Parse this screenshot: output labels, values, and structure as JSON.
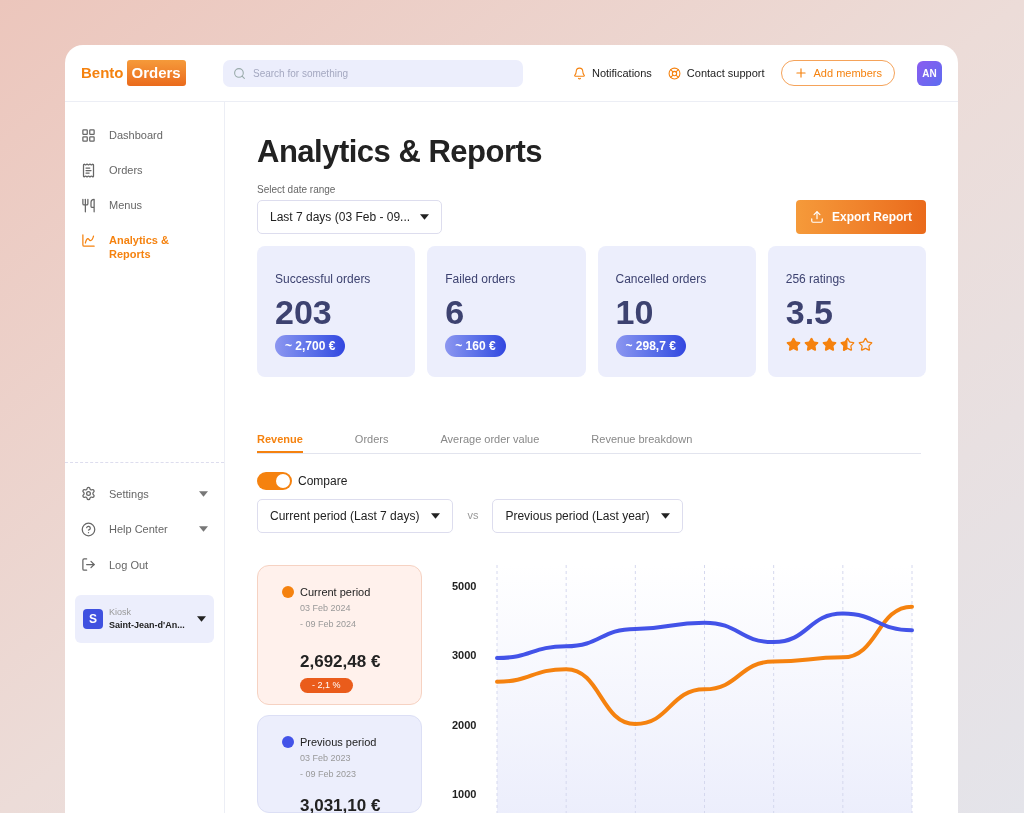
{
  "logo": {
    "part_1": "Bento",
    "part_2": "Orders"
  },
  "search": {
    "placeholder": "Search for something"
  },
  "header_actions": [
    {
      "label": "Notifications",
      "kind": "bell"
    },
    {
      "label": "Contact support",
      "kind": "lifebuoy"
    }
  ],
  "add_button": "Add members",
  "avatar": "AN",
  "sidebar": {
    "items": [
      {
        "label": "Dashboard",
        "kind": "grid",
        "selected": false
      },
      {
        "label": "Orders",
        "kind": "list",
        "selected": false
      },
      {
        "label": "Menus",
        "kind": "cutlery",
        "selected": false
      },
      {
        "label": "Analytics & Reports",
        "kind": "chart",
        "selected": true
      }
    ],
    "bottom_items": [
      {
        "label": "Settings",
        "kind": "gear",
        "expandable": true
      },
      {
        "label": "Help Center",
        "kind": "help",
        "expandable": true
      },
      {
        "label": "Log Out",
        "kind": "logout",
        "expandable": false
      }
    ],
    "workspace": {
      "badge": "S",
      "type": "Kiosk",
      "name": "Saint-Jean-d'An..."
    }
  },
  "page": {
    "title": "Analytics & Reports",
    "date_range": {
      "label": "Select date range",
      "value": "Last 7 days (03 Feb - 09..."
    },
    "export_button": "Export Report"
  },
  "stats": [
    {
      "kind": "amount",
      "label": "Successful orders",
      "value": "203",
      "amount": "~ 2,700 €"
    },
    {
      "kind": "amount",
      "label": "Failed orders",
      "value": "6",
      "amount": "~ 160 €"
    },
    {
      "kind": "amount",
      "label": "Cancelled orders",
      "value": "10",
      "amount": "~ 298,7 €"
    },
    {
      "kind": "rating",
      "label": "256 ratings",
      "value": "3.5",
      "stars": 3.5
    }
  ],
  "tabs": [
    {
      "label": "Revenue",
      "selected": true
    },
    {
      "label": "Orders",
      "selected": false
    },
    {
      "label": "Average order value",
      "selected": false
    },
    {
      "label": "Revenue breakdown",
      "selected": false
    }
  ],
  "compare": {
    "label": "Compare",
    "on": true
  },
  "period_selects": [
    "Current period (Last 7 days)",
    "Previous period (Last year)"
  ],
  "vs": "vs",
  "legend_cards": [
    {
      "title": "Current period",
      "color": "#f5820f",
      "date_from": "03 Feb 2024",
      "date_to": "- 09 Feb 2024",
      "total": "2,692,48 €",
      "change": "- 2,1 %"
    },
    {
      "title": "Previous period",
      "color": "#4353e8",
      "date_from": "03 Feb 2023",
      "date_to": "- 09 Feb 2023",
      "total": "3,031,10 €"
    }
  ],
  "chart": {
    "y_axis_labels": [
      "5000",
      "3000",
      "2000",
      "1000"
    ]
  }
}
